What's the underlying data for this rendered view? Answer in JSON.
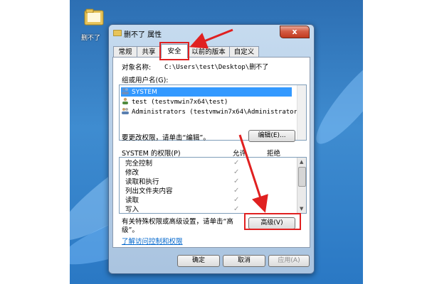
{
  "desktop": {
    "folder_label": "删不了"
  },
  "window": {
    "title": "删不了 属性",
    "close_label": "x",
    "tabs": [
      {
        "label": "常规"
      },
      {
        "label": "共享"
      },
      {
        "label": "安全"
      },
      {
        "label": "以前的版本"
      },
      {
        "label": "自定义"
      }
    ],
    "active_tab": "安全",
    "object_name_label": "对象名称:",
    "object_name_value": "C:\\Users\\test\\Desktop\\删不了",
    "group_label": "组或用户名(G):",
    "users": [
      {
        "name": "SYSTEM",
        "selected": true
      },
      {
        "name": "test (testvmwin7x64\\test)",
        "selected": false
      },
      {
        "name": "Administrators (testvmwin7x64\\Administrators)",
        "selected": false
      }
    ],
    "change_perm_text": "要更改权限，请单击“编辑”。",
    "edit_button": "编辑(E)...",
    "perm_header": "SYSTEM 的权限(P)",
    "allow_header": "允许",
    "deny_header": "拒绝",
    "permissions": [
      {
        "name": "完全控制",
        "allow": true
      },
      {
        "name": "修改",
        "allow": true
      },
      {
        "name": "读取和执行",
        "allow": true
      },
      {
        "name": "列出文件夹内容",
        "allow": true
      },
      {
        "name": "读取",
        "allow": true
      },
      {
        "name": "写入",
        "allow": true
      }
    ],
    "special_text_line1": "有关特殊权限或高级设置，请单击“高",
    "special_text_line2": "级”。",
    "advanced_button": "高级(V)",
    "learn_link": "了解访问控制和权限",
    "ok_button": "确定",
    "cancel_button": "取消",
    "apply_button": "应用(A)"
  },
  "colors": {
    "highlight_box": "#e02020",
    "selection": "#3399ff",
    "link": "#0066cc"
  }
}
